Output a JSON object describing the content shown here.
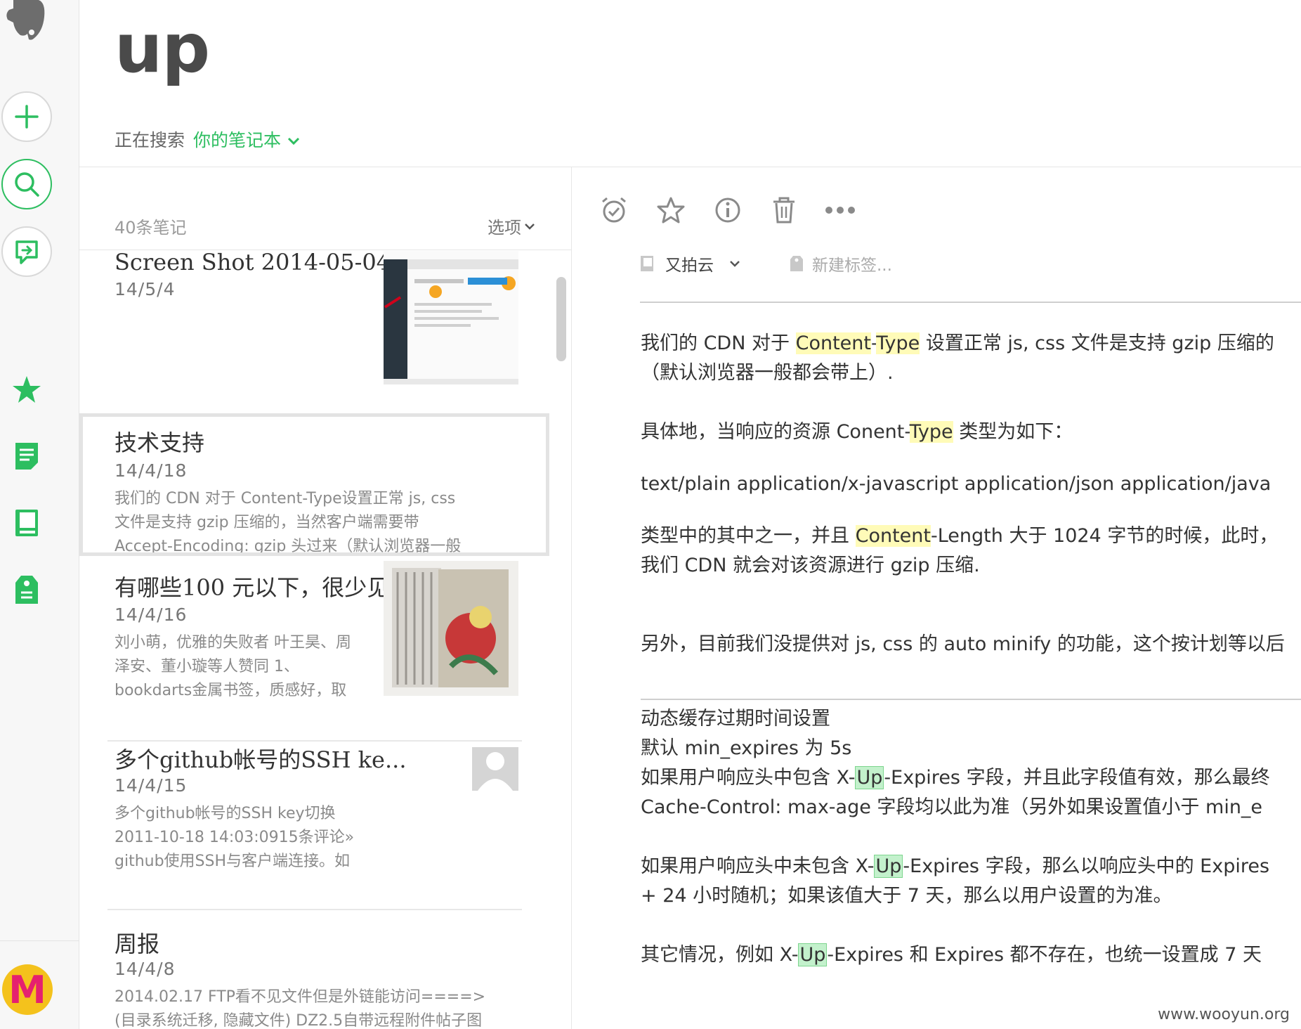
{
  "header": {
    "title": "up",
    "searching_label": "正在搜索",
    "scope_label": "你的笔记本"
  },
  "list": {
    "count": "40条笔记",
    "options_label": "选项",
    "notes": [
      {
        "title": "Screen Shot 2014-05-04 ...",
        "date": "14/5/4",
        "snippet": ""
      },
      {
        "title": "技术支持",
        "date": "14/4/18",
        "snippet": "我们的 CDN 对于 Content-Type设置正常 js, css\n文件是支持 gzip 压缩的，当然客户端需要带\nAccept-Encoding: gzip 头过来（默认浏览器一般"
      },
      {
        "title": "有哪些100 元以下，很少见...",
        "date": "14/4/16",
        "snippet": "刘小萌，优雅的失败者 叶王昊、周\n泽安、董小璇等人赞同 1、\nbookdarts金属书签，质感好，取"
      },
      {
        "title": "多个github帐号的SSH ke...",
        "date": "14/4/15",
        "snippet": "多个github帐号的SSH key切换\n2011-10-18 14:03:0915条评论»\ngithub使用SSH与客户端连接。如"
      },
      {
        "title": "周报",
        "date": "14/4/8",
        "snippet": "2014.02.17 FTP看不见文件但是外链能访问====>\n(目录系统迁移, 隐藏文件) DZ2.5自带远程附件帖子图"
      }
    ]
  },
  "editor": {
    "notebook": "又拍云",
    "tag_placeholder": "新建标签...",
    "p1a_pre": "我们的 CDN 对于 ",
    "p1a_hl1": "Content",
    "p1a_mid": "-",
    "p1a_hl2": "Type",
    "p1a_post": " 设置正常 js, css 文件是支持 gzip 压缩的",
    "p1b": "（默认浏览器一般都会带上）.",
    "p2_pre": "具体地，当响应的资源 Conent-",
    "p2_hl": "Type",
    "p2_post": " 类型为如下：",
    "p3": "text/plain application/x-javascript application/json application/java",
    "p4a_pre": "类型中的其中之一，并且 ",
    "p4a_hl": "Content",
    "p4a_post": "-Length 大于 1024 字节的时候，此时，",
    "p4b": "我们 CDN 就会对该资源进行 gzip 压缩.",
    "p5": "另外，目前我们没提供对 js, css 的 auto minify 的功能，这个按计划等以后",
    "p6": "动态缓存过期时间设置",
    "p7": "默认 min_expires 为 5s",
    "p8_pre": "如果用户响应头中包含 X-",
    "p8_hl": "Up",
    "p8_post": "-Expires 字段，并且此字段值有效，那么最终",
    "p9": "Cache-Control: max-age 字段均以此为准（另外如果设置值小于 min_e",
    "p10_pre": "如果用户响应头中未包含 X-",
    "p10_hl": "Up",
    "p10_post": "-Expires 字段，那么以响应头中的 Expires",
    "p11": "+ 24 小时随机；如果该值大于 7 天，那么以用户设置的为准。",
    "p12_pre": "其它情况，例如 X-",
    "p12_hl": "Up",
    "p12_post": "-Expires 和 Expires 都不存在，也统一设置成 7 天"
  },
  "watermark": "www.wooyun.org",
  "avatar_letter": "M",
  "colors": {
    "accent": "#2dbe60",
    "highlight_yellow": "#fffbb8",
    "highlight_green": "#c3f1cc",
    "avatar_bg": "#f4c21c",
    "avatar_letter": "#e5216f"
  },
  "icons": [
    "evernote-logo-icon",
    "new-note-icon",
    "search-icon",
    "work-chat-icon",
    "shortcuts-star-icon",
    "notes-icon",
    "notebooks-icon",
    "tags-icon",
    "reminder-icon",
    "star-icon",
    "info-icon",
    "trash-icon",
    "more-icon",
    "notebook-icon",
    "tag-icon",
    "chevron-down-icon"
  ]
}
